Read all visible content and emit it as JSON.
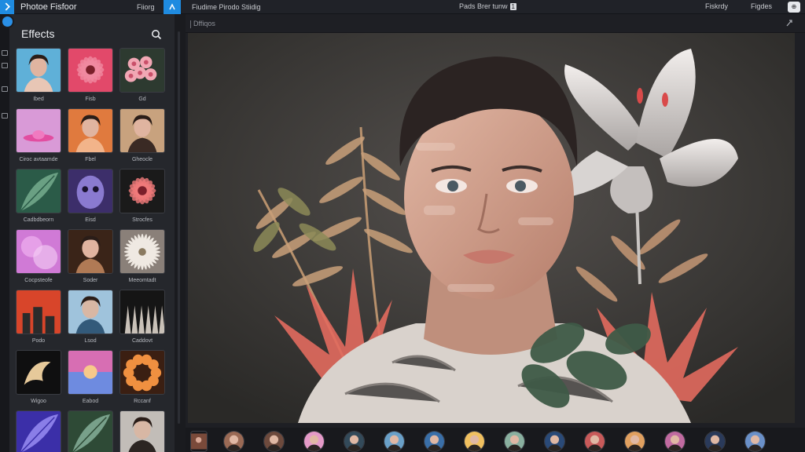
{
  "app": {
    "title": "Photoe Fisfoor",
    "menu": "Fiiorg",
    "document_title": "Fiudime Pirodo Stiidig",
    "center_label": "Pads Brer tunw",
    "center_badge": "1",
    "right_items": [
      "Fiskrdy",
      "Figdes"
    ],
    "corner_button": "⊕"
  },
  "panel": {
    "title": "Effects",
    "search_icon": "search-icon",
    "tiles": [
      {
        "label": "Ibed"
      },
      {
        "label": "Fisb"
      },
      {
        "label": "Gd"
      },
      {
        "label": "Ciroc avtaamde"
      },
      {
        "label": "Fbel"
      },
      {
        "label": "Gheocle"
      },
      {
        "label": "Cadbdbeorn"
      },
      {
        "label": "Eisd"
      },
      {
        "label": "Strocfes"
      },
      {
        "label": "Cocpsteofe"
      },
      {
        "label": "Soder"
      },
      {
        "label": "Meeomtadt"
      },
      {
        "label": "Podo"
      },
      {
        "label": "Lsod"
      },
      {
        "label": "Caddovt"
      },
      {
        "label": "Wigoo"
      },
      {
        "label": "Eabod"
      },
      {
        "label": "Rccanf"
      },
      {
        "label": ""
      },
      {
        "label": ""
      },
      {
        "label": ""
      }
    ]
  },
  "main": {
    "layer_name": "Dffiqos",
    "expand_icon": "expand-icon"
  },
  "colors": {
    "accent": "#1f8be0",
    "panel_bg": "#25272c",
    "app_bg": "#1c1d21"
  }
}
